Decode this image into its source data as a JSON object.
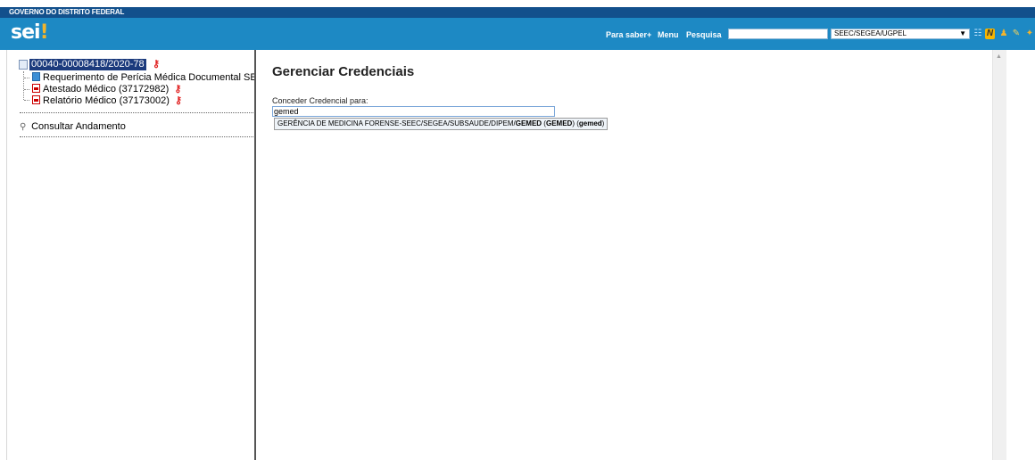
{
  "header": {
    "gov_title": "GOVERNO DO DISTRITO FEDERAL",
    "logo_text": "sei",
    "logo_dot": "!",
    "nav": {
      "para_saber": "Para saber+",
      "menu": "Menu",
      "pesquisa": "Pesquisa"
    },
    "search_value": "",
    "unit_selected": "SEEC/SEGEA/UGPEL",
    "colors": {
      "gov_bar": "#12508c",
      "header": "#1d89c4",
      "logo_accent": "#f2b42c"
    },
    "icons": [
      "list-icon",
      "new-icon",
      "user-icon",
      "tools-icon",
      "exit-icon"
    ]
  },
  "tree": {
    "process_number": "00040-00008418/2020-78",
    "documents": [
      {
        "label": "Requerimento de Perícia Médica Documental SEE",
        "icon": "document-icon",
        "credential": false
      },
      {
        "label": "Atestado Médico (37172982)",
        "icon": "pdf-icon",
        "credential": true
      },
      {
        "label": "Relatório Médico (37173002)",
        "icon": "pdf-icon",
        "credential": true
      }
    ],
    "consult_label": "Consultar Andamento"
  },
  "main": {
    "title": "Gerenciar Credenciais",
    "field_label": "Conceder Credencial para:",
    "field_value": "gemed",
    "suggestion": {
      "prefix": "GERÊNCIA DE MEDICINA FORENSE-SEEC/SEGEA/SUBSAUDE/DIPEM/",
      "strong1": "GEMED",
      "mid1": " (",
      "strong2": "GEMED",
      "mid2": ") (",
      "strong3": "gemed",
      "suffix": ")"
    }
  }
}
